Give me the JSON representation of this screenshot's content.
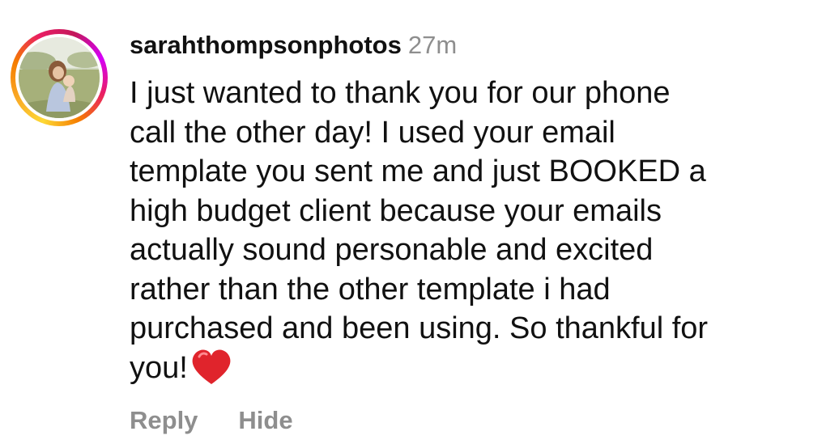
{
  "comment": {
    "username": "sarahthompsonphotos",
    "timestamp": "27m",
    "lines": [
      "I just wanted to thank you for our phone",
      "call the other day! I used your email",
      "template you sent me and just BOOKED a",
      "high budget client because your emails",
      "actually sound personable and excited",
      "rather than the other template i had",
      "purchased and been using. So thankful for",
      "you!"
    ],
    "emoji": "red-heart-icon"
  },
  "actions": {
    "reply_label": "Reply",
    "hide_label": "Hide"
  },
  "colors": {
    "text": "#111111",
    "muted": "#8e8e8e",
    "heart": "#e0242c"
  }
}
